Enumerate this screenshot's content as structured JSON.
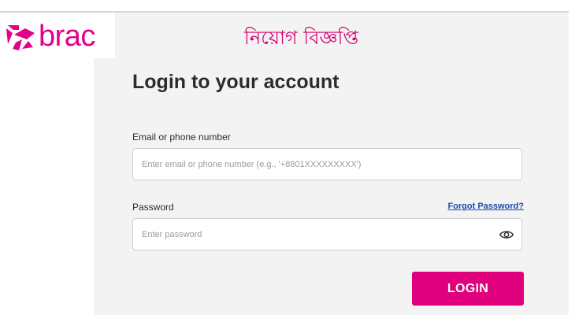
{
  "brand": {
    "name": "brac",
    "logo_icon": "brac-logo-icon",
    "color": "#e3008c"
  },
  "banner": {
    "text": "নিয়োগ বিজ্ঞপ্তি",
    "color": "#d6006e"
  },
  "login": {
    "heading": "Login to your account",
    "email_label": "Email or phone number",
    "email_placeholder": "Enter email or phone number (e.g., '+8801XXXXXXXXX')",
    "password_label": "Password",
    "password_placeholder": "Enter password",
    "forgot_link": "Forgot Password?",
    "forgot_color": "#1f4aa8",
    "show_password_icon": "eye-icon",
    "submit_label": "LOGIN",
    "submit_color": "#e0007d"
  }
}
